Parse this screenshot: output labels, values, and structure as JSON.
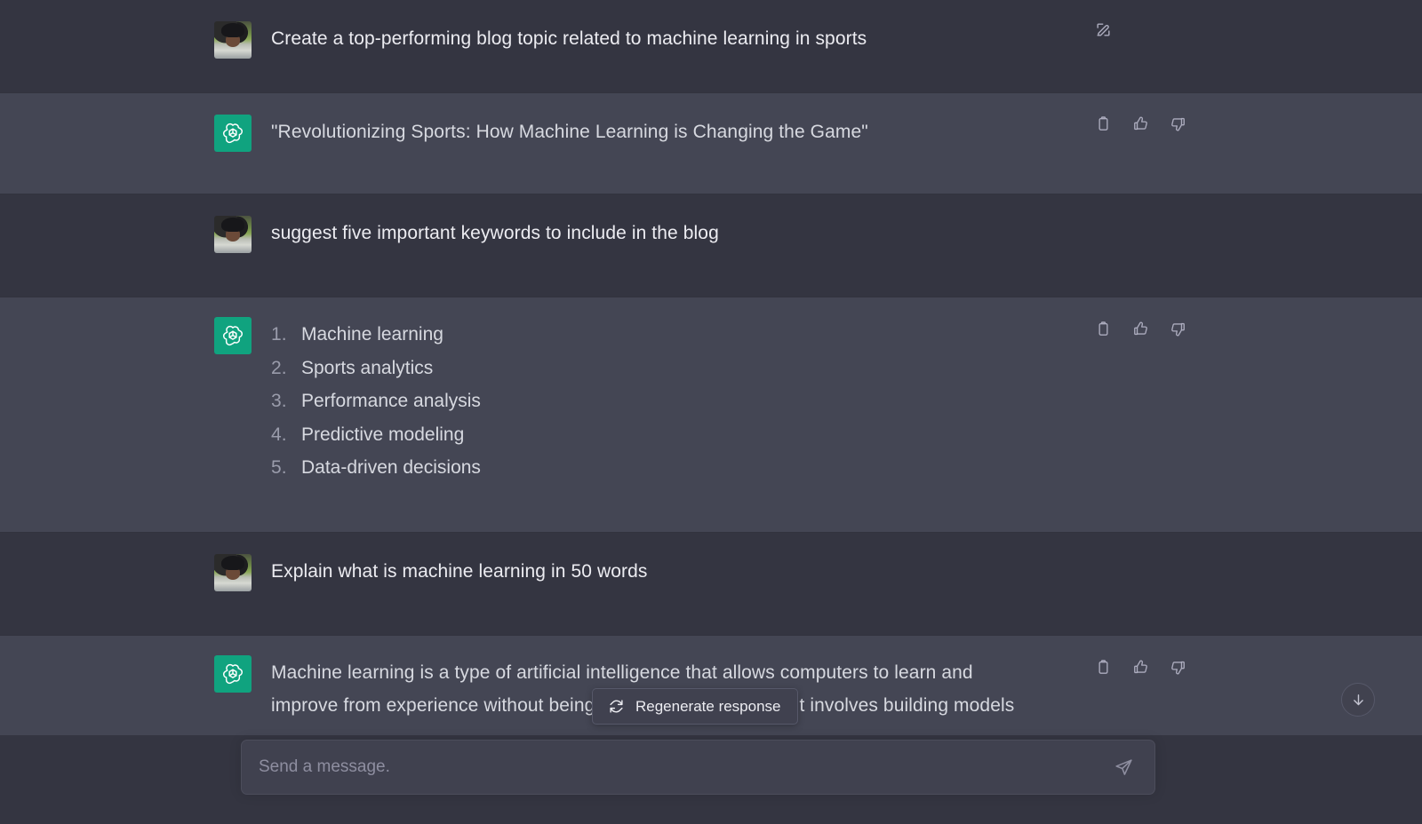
{
  "app": {
    "title": "ChatGPT"
  },
  "colors": {
    "user_row_bg": "#343541",
    "assistant_row_bg": "#444654",
    "brand_green": "#10a37f",
    "text_primary": "#ececf1",
    "text_secondary": "#d7d9e0",
    "muted": "#8e8ea0",
    "composer_bg": "#40414f"
  },
  "messages": [
    {
      "role": "user",
      "avatar": "user-photo-avatar",
      "text": "Create a top-performing blog topic related to machine learning in sports",
      "actions": [
        "edit"
      ]
    },
    {
      "role": "assistant",
      "avatar": "chatgpt-logo",
      "text": "\"Revolutionizing Sports: How Machine Learning is Changing the Game\"",
      "actions": [
        "copy",
        "thumbs-up",
        "thumbs-down"
      ]
    },
    {
      "role": "user",
      "avatar": "user-photo-avatar",
      "text": "suggest five important keywords to include in the blog",
      "actions": []
    },
    {
      "role": "assistant",
      "avatar": "chatgpt-logo",
      "list": [
        "Machine learning",
        "Sports analytics",
        "Performance analysis",
        "Predictive modeling",
        "Data-driven decisions"
      ],
      "actions": [
        "copy",
        "thumbs-up",
        "thumbs-down"
      ]
    },
    {
      "role": "user",
      "avatar": "user-photo-avatar",
      "text": "Explain what is machine learning in 50 words",
      "actions": []
    },
    {
      "role": "assistant",
      "avatar": "chatgpt-logo",
      "text": "Machine learning is a type of artificial intelligence that allows computers to learn and improve from experience without being explicitly programmed. It involves building models",
      "actions": [
        "copy",
        "thumbs-up",
        "thumbs-down"
      ]
    }
  ],
  "regenerate": {
    "label": "Regenerate response",
    "icon": "refresh-icon"
  },
  "composer": {
    "placeholder": "Send a message.",
    "value": "",
    "send_icon": "send-icon"
  },
  "scroll_button": {
    "icon": "arrow-down-icon"
  },
  "action_icons": {
    "edit": "edit-icon",
    "copy": "copy-icon",
    "thumbs_up": "thumbs-up-icon",
    "thumbs_down": "thumbs-down-icon"
  }
}
